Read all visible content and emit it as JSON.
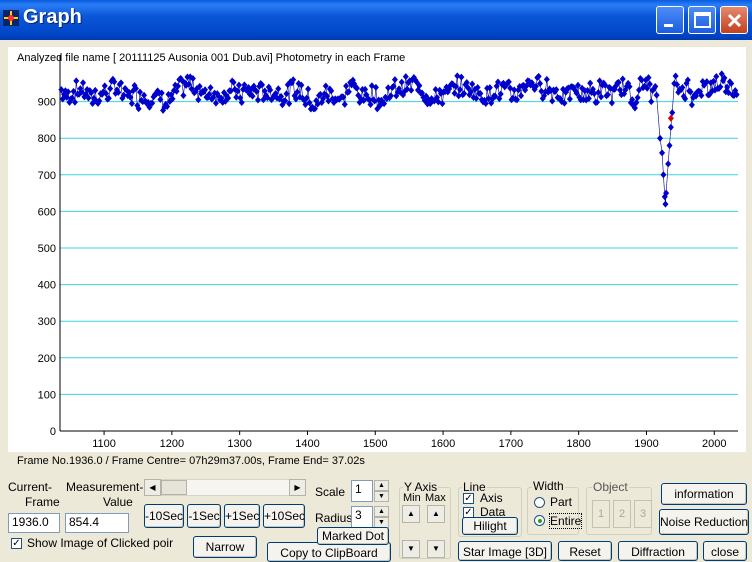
{
  "window": {
    "title": "Graph"
  },
  "plot": {
    "header": "Analyzed file name [ 20111125 Ausonia 001 Dub.avi]   Photometry in each Frame",
    "footer": "Frame No.1936.0 / Frame Centre= 07h29m37.00s,  Frame End= 37.02s"
  },
  "chart_data": {
    "type": "scatter",
    "xlim": [
      1035,
      2035
    ],
    "ylim": [
      0,
      1000
    ],
    "x_ticks": [
      "1100",
      "1200",
      "1300",
      "1400",
      "1500",
      "1600",
      "1700",
      "1800",
      "1900",
      "2000"
    ],
    "y_ticks": [
      "0",
      "100",
      "200",
      "300",
      "400",
      "500",
      "600",
      "700",
      "800",
      "900"
    ],
    "grid": true,
    "series": [
      {
        "name": "",
        "color": "#0000cc",
        "baseline_y": 930,
        "dip": [
          [
            1920,
            800
          ],
          [
            1923,
            760
          ],
          [
            1925,
            700
          ],
          [
            1927,
            640
          ],
          [
            1928,
            620
          ],
          [
            1929,
            650
          ],
          [
            1932,
            730
          ],
          [
            1934,
            780
          ],
          [
            1936,
            830
          ],
          [
            1938,
            870
          ]
        ]
      },
      {
        "name": "",
        "color": "#e00000",
        "points": [
          [
            1936,
            854.4
          ]
        ]
      }
    ]
  },
  "controls": {
    "current_frame_label_1": "Current-",
    "current_frame_label_2": "Frame",
    "current_frame_value": "1936.0",
    "measurement_label_1": "Measurement-",
    "measurement_label_2": "Value",
    "measurement_value": "854.4",
    "show_image_label": "Show Image of Clicked poir",
    "narrow_label": "Narrow",
    "minus10": "-10Sec",
    "minus1": "-1Sec",
    "plus1": "+1Sec",
    "plus10": "+10Sec",
    "copy_clipboard": "Copy to ClipBoard",
    "scale_label": "Scale",
    "scale_value": "1",
    "radius_label": "Radius",
    "radius_value": "3",
    "marked_dot": "Marked Dot",
    "y_axis_label": "Y Axis",
    "y_min": "Min",
    "y_max": "Max",
    "line_label": "Line",
    "axis_label": "Axis",
    "data_label": "Data",
    "hilight": "Hilight",
    "width_label": "Width",
    "part_label": "Part",
    "entire_label": "Entire",
    "object_label": "Object",
    "obj1": "1",
    "obj2": "2",
    "obj3": "3",
    "information": "information",
    "noise_reduction": "Noise Reduction",
    "star_image": "Star Image [3D]",
    "reset": "Reset",
    "diffraction": "Diffraction",
    "close": "close"
  }
}
